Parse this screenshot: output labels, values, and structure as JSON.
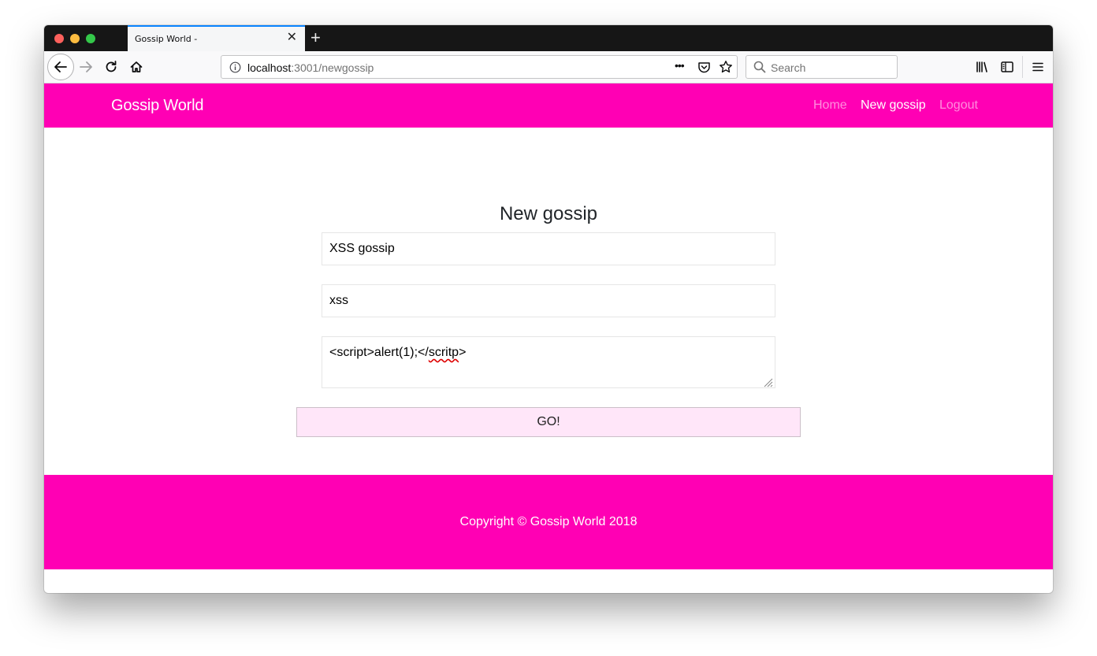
{
  "browser": {
    "tab_title": "Gossip World -",
    "tab_close": "✕",
    "new_tab": "+",
    "url_host": "localhost",
    "url_rest": ":3001/newgossip",
    "search_placeholder": "Search",
    "page_actions": "•••"
  },
  "site": {
    "brand": "Gossip World",
    "nav": {
      "home": "Home",
      "new_gossip": "New gossip",
      "logout": "Logout"
    },
    "accent_color": "#ff00b4"
  },
  "form": {
    "title": "New gossip",
    "title_value": "XSS gossip",
    "tag_value": "xss",
    "body_prefix": "<script>alert(1);</",
    "body_misspelled": "scritp",
    "body_suffix": ">",
    "submit_label": "GO!"
  },
  "footer": {
    "copyright": "Copyright © Gossip World 2018"
  }
}
